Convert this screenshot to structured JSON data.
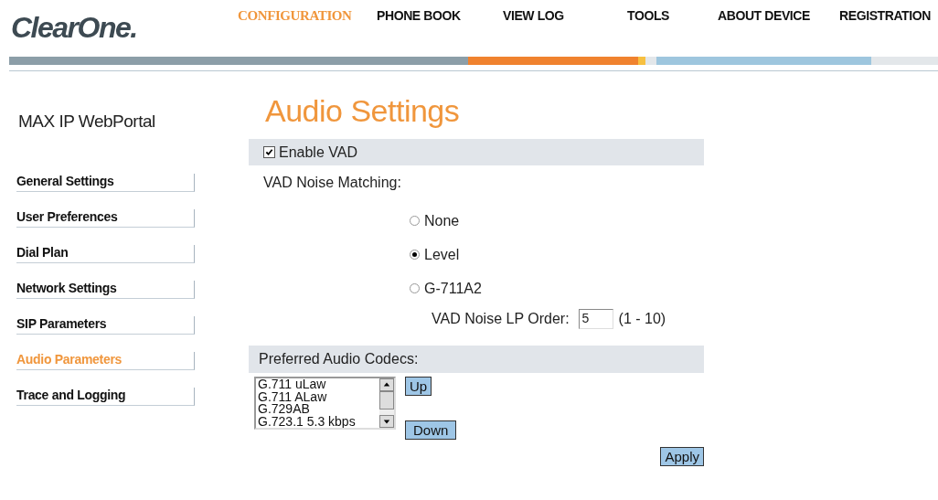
{
  "header": {
    "logo": "ClearOne.",
    "nav": [
      {
        "label": "CONFIGURATION",
        "selected": true
      },
      {
        "label": "PHONE BOOK",
        "selected": false
      },
      {
        "label": "VIEW LOG",
        "selected": false
      },
      {
        "label": "TOOLS",
        "selected": false
      },
      {
        "label": "ABOUT DEVICE",
        "selected": false
      },
      {
        "label": "REGISTRATION",
        "selected": false
      }
    ]
  },
  "sidebar": {
    "title": "MAX IP WebPortal",
    "items": [
      {
        "label": "General Settings",
        "selected": false
      },
      {
        "label": "User Preferences",
        "selected": false
      },
      {
        "label": "Dial Plan",
        "selected": false
      },
      {
        "label": "Network Settings",
        "selected": false
      },
      {
        "label": "SIP Parameters",
        "selected": false
      },
      {
        "label": "Audio Parameters",
        "selected": true
      },
      {
        "label": "Trace and Logging",
        "selected": false
      }
    ]
  },
  "main": {
    "title": "Audio Settings",
    "enable_vad": {
      "label": "Enable VAD",
      "checked": true
    },
    "noise_matching": {
      "label": "VAD Noise Matching:",
      "options": [
        {
          "label": "None",
          "selected": false
        },
        {
          "label": "Level",
          "selected": true
        },
        {
          "label": "G-711A2",
          "selected": false
        }
      ]
    },
    "lp_order": {
      "label": "VAD Noise LP Order:",
      "value": "5",
      "range": "(1 - 10)"
    },
    "codecs": {
      "label": "Preferred Audio Codecs:",
      "items": [
        "G.711 uLaw",
        "G.711 ALaw",
        "G.729AB",
        "G.723.1 5.3 kbps"
      ],
      "up": "Up",
      "down": "Down"
    },
    "apply": "Apply"
  }
}
